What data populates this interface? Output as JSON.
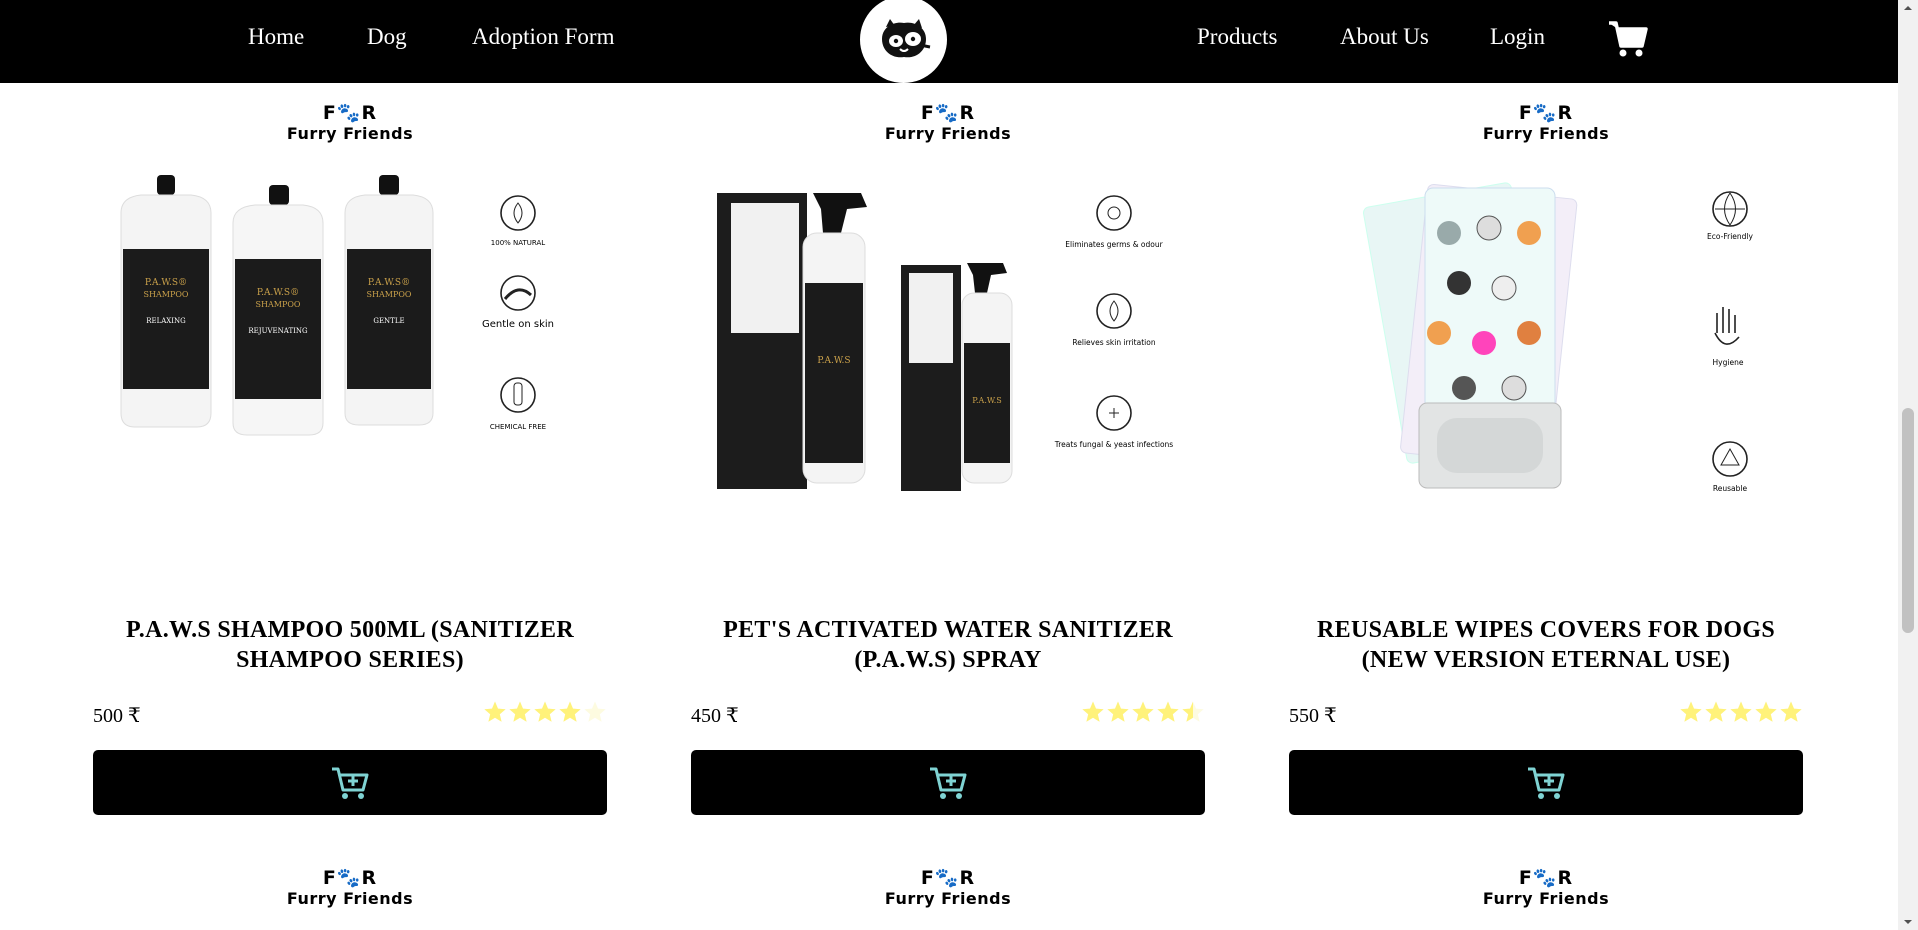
{
  "nav": {
    "left_links": [
      "Home",
      "Dog",
      "Adoption Form"
    ],
    "right_links": [
      "Products",
      "About Us",
      "Login"
    ],
    "logo_icon": "cat-dog-logo-icon",
    "cart_icon": "cart-icon"
  },
  "brand": {
    "line1": "F🐾R",
    "line2": "Furry Friends"
  },
  "products": [
    {
      "title": "P.A.W.S SHAMPOO 500ML (SANITIZER SHAMPOO SERIES)",
      "price": "500 ₹",
      "rating": 4,
      "features": [
        "100% NATURAL",
        "Gentle on skin",
        "CHEMICAL FREE"
      ],
      "bottle_labels": [
        "RELAXING",
        "REJUVENATING",
        "GENTLE"
      ],
      "bottle_brand": "P.A.W.S®",
      "bottle_sub": "SHAMPOO"
    },
    {
      "title": "PET'S ACTIVATED WATER SANITIZER (P.A.W.S) SPRAY",
      "price": "450 ₹",
      "rating": 4.5,
      "features": [
        "Eliminates germs & odour",
        "Relieves skin irritation",
        "Treats fungal & yeast infections"
      ],
      "bottle_brand": "P.A.W.S"
    },
    {
      "title": "REUSABLE WIPES COVERS FOR DOGS (NEW VERSION ETERNAL USE)",
      "price": "550 ₹",
      "rating": 5,
      "features": [
        "Eco-Friendly",
        "Hygiene",
        "Reusable"
      ]
    }
  ],
  "colors": {
    "nav_bg": "#000000",
    "button_bg": "#000000",
    "cart_button_icon": "#7fd3d3",
    "star": "#fff27a"
  }
}
